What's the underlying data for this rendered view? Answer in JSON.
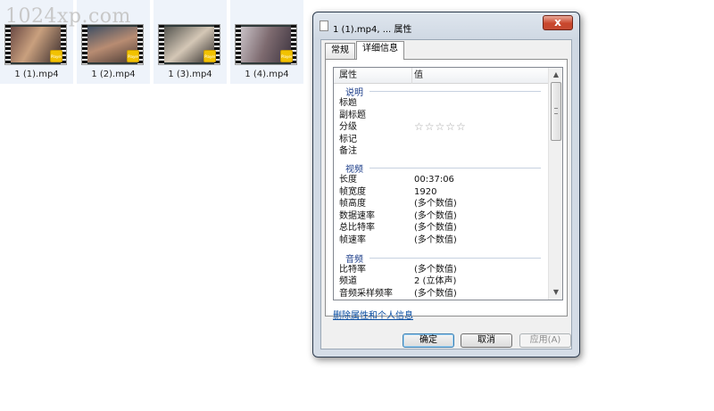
{
  "watermark": "1024xp.com",
  "files": [
    {
      "name": "1 (1).mp4",
      "badge": "Player",
      "selected": true
    },
    {
      "name": "1 (2).mp4",
      "badge": "Player",
      "selected": true
    },
    {
      "name": "1 (3).mp4",
      "badge": "Player",
      "selected": true
    },
    {
      "name": "1 (4).mp4",
      "badge": "Player",
      "selected": true
    }
  ],
  "dialog": {
    "title": "1 (1).mp4, ... 属性",
    "close_glyph": "x",
    "tabs": [
      {
        "label": "常规",
        "active": false
      },
      {
        "label": "详细信息",
        "active": true
      }
    ],
    "list": {
      "col_property": "属性",
      "col_value": "值",
      "groups": [
        {
          "label": "说明",
          "rows": [
            {
              "k": "标题",
              "v": ""
            },
            {
              "k": "副标题",
              "v": ""
            },
            {
              "k": "分级",
              "v": "",
              "stars": 5
            },
            {
              "k": "标记",
              "v": ""
            },
            {
              "k": "备注",
              "v": ""
            }
          ]
        },
        {
          "label": "视频",
          "rows": [
            {
              "k": "长度",
              "v": "00:37:06"
            },
            {
              "k": "帧宽度",
              "v": "1920"
            },
            {
              "k": "帧高度",
              "v": "(多个数值)"
            },
            {
              "k": "数据速率",
              "v": "(多个数值)"
            },
            {
              "k": "总比特率",
              "v": "(多个数值)"
            },
            {
              "k": "帧速率",
              "v": "(多个数值)"
            }
          ]
        },
        {
          "label": "音频",
          "rows": [
            {
              "k": "比特率",
              "v": "(多个数值)"
            },
            {
              "k": "频道",
              "v": "2 (立体声)"
            },
            {
              "k": "音频采样频率",
              "v": "(多个数值)"
            }
          ]
        }
      ]
    },
    "remove_link": "删除属性和个人信息",
    "buttons": {
      "ok": "确定",
      "cancel": "取消",
      "apply": "应用(A)"
    }
  },
  "colors": {
    "group_header": "#1e3f8a",
    "link": "#0b4fa3",
    "close_button": "#c9462c",
    "thumb_badge": "#f2c200"
  }
}
